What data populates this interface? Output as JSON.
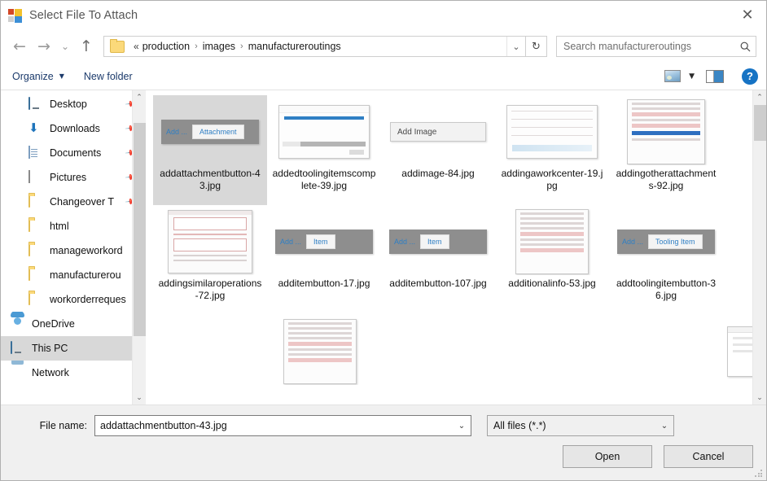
{
  "window": {
    "title": "Select File To Attach",
    "app_icon": "app-tiles-icon",
    "close_label": "✕"
  },
  "nav": {
    "back_label": "←",
    "forward_label": "→",
    "recent_label": "⌄",
    "up_label": "↑",
    "overflow_label": "«",
    "separator": "›",
    "crumbs": [
      "production",
      "images",
      "manufactureroutings"
    ],
    "crumb_dropdown_label": "⌄",
    "refresh_label": "↻"
  },
  "search": {
    "placeholder": "Search manufactureroutings",
    "icon": "search-icon"
  },
  "commandbar": {
    "organize_label": "Organize",
    "organize_caret": "▼",
    "new_folder_label": "New folder",
    "view_caret": "▼",
    "help_label": "?"
  },
  "sidebar": {
    "items": [
      {
        "label": "Desktop",
        "icon": "monitor-icon",
        "pinned": true,
        "indent": true,
        "selected": false
      },
      {
        "label": "Downloads",
        "icon": "download-icon",
        "pinned": true,
        "indent": true,
        "selected": false
      },
      {
        "label": "Documents",
        "icon": "document-icon",
        "pinned": true,
        "indent": true,
        "selected": false
      },
      {
        "label": "Pictures",
        "icon": "picture-icon",
        "pinned": true,
        "indent": true,
        "selected": false
      },
      {
        "label": "Changeover T",
        "icon": "folder-icon",
        "pinned": true,
        "indent": true,
        "selected": false
      },
      {
        "label": "html",
        "icon": "folder-icon",
        "pinned": false,
        "indent": true,
        "selected": false
      },
      {
        "label": "manageworkord",
        "icon": "folder-icon",
        "pinned": false,
        "indent": true,
        "selected": false
      },
      {
        "label": "manufacturerou",
        "icon": "folder-icon",
        "pinned": false,
        "indent": true,
        "selected": false
      },
      {
        "label": "workorderreques",
        "icon": "folder-icon",
        "pinned": false,
        "indent": true,
        "selected": false
      },
      {
        "label": "OneDrive",
        "icon": "cloud-icon",
        "pinned": false,
        "indent": false,
        "selected": false
      },
      {
        "label": "This PC",
        "icon": "monitor-icon",
        "pinned": false,
        "indent": false,
        "selected": true
      },
      {
        "label": "Network",
        "icon": "network-icon",
        "pinned": false,
        "indent": false,
        "selected": false
      }
    ],
    "pin_glyph": "📌",
    "scroll_up": "⌃",
    "scroll_down": "⌄"
  },
  "files": {
    "scroll_up": "⌃",
    "scroll_down": "⌄",
    "items": [
      {
        "name": "addattachmentbutton-43.jpg",
        "selected": true,
        "thumb": "button-bar",
        "thumb_add": "Add ...",
        "thumb_btn": "Attachment"
      },
      {
        "name": "addedtoolingitemscomplete-39.jpg",
        "selected": false,
        "thumb": "window",
        "thumb_add": "",
        "thumb_btn": ""
      },
      {
        "name": "addimage-84.jpg",
        "selected": false,
        "thumb": "plain-button",
        "thumb_add": "Add Image",
        "thumb_btn": ""
      },
      {
        "name": "addingaworkcenter-19.jpg",
        "selected": false,
        "thumb": "grid-form",
        "thumb_add": "",
        "thumb_btn": ""
      },
      {
        "name": "addingotherattachments-92.jpg",
        "selected": false,
        "thumb": "tall-form",
        "thumb_add": "",
        "thumb_btn": ""
      },
      {
        "name": "addingsimilaroperations-72.jpg",
        "selected": false,
        "thumb": "dialog-form",
        "thumb_add": "",
        "thumb_btn": ""
      },
      {
        "name": "additembutton-17.jpg",
        "selected": false,
        "thumb": "button-bar",
        "thumb_add": "Add ...",
        "thumb_btn": "Item"
      },
      {
        "name": "additembutton-107.jpg",
        "selected": false,
        "thumb": "button-bar",
        "thumb_add": "Add ...",
        "thumb_btn": "Item"
      },
      {
        "name": "additionalinfo-53.jpg",
        "selected": false,
        "thumb": "long-form",
        "thumb_add": "",
        "thumb_btn": ""
      },
      {
        "name": "addtoolingitembutton-36.jpg",
        "selected": false,
        "thumb": "button-bar",
        "thumb_add": "Add ...",
        "thumb_btn": "Tooling Item"
      }
    ],
    "partial_row": [
      {
        "thumb": "long-form"
      },
      {
        "thumb": "list-form"
      }
    ]
  },
  "footer": {
    "filename_label": "File name:",
    "filename_value": "addattachmentbutton-43.jpg",
    "filename_caret": "⌄",
    "filter_value": "All files (*.*)",
    "filter_caret": "⌄",
    "open_label": "Open",
    "cancel_label": "Cancel"
  }
}
